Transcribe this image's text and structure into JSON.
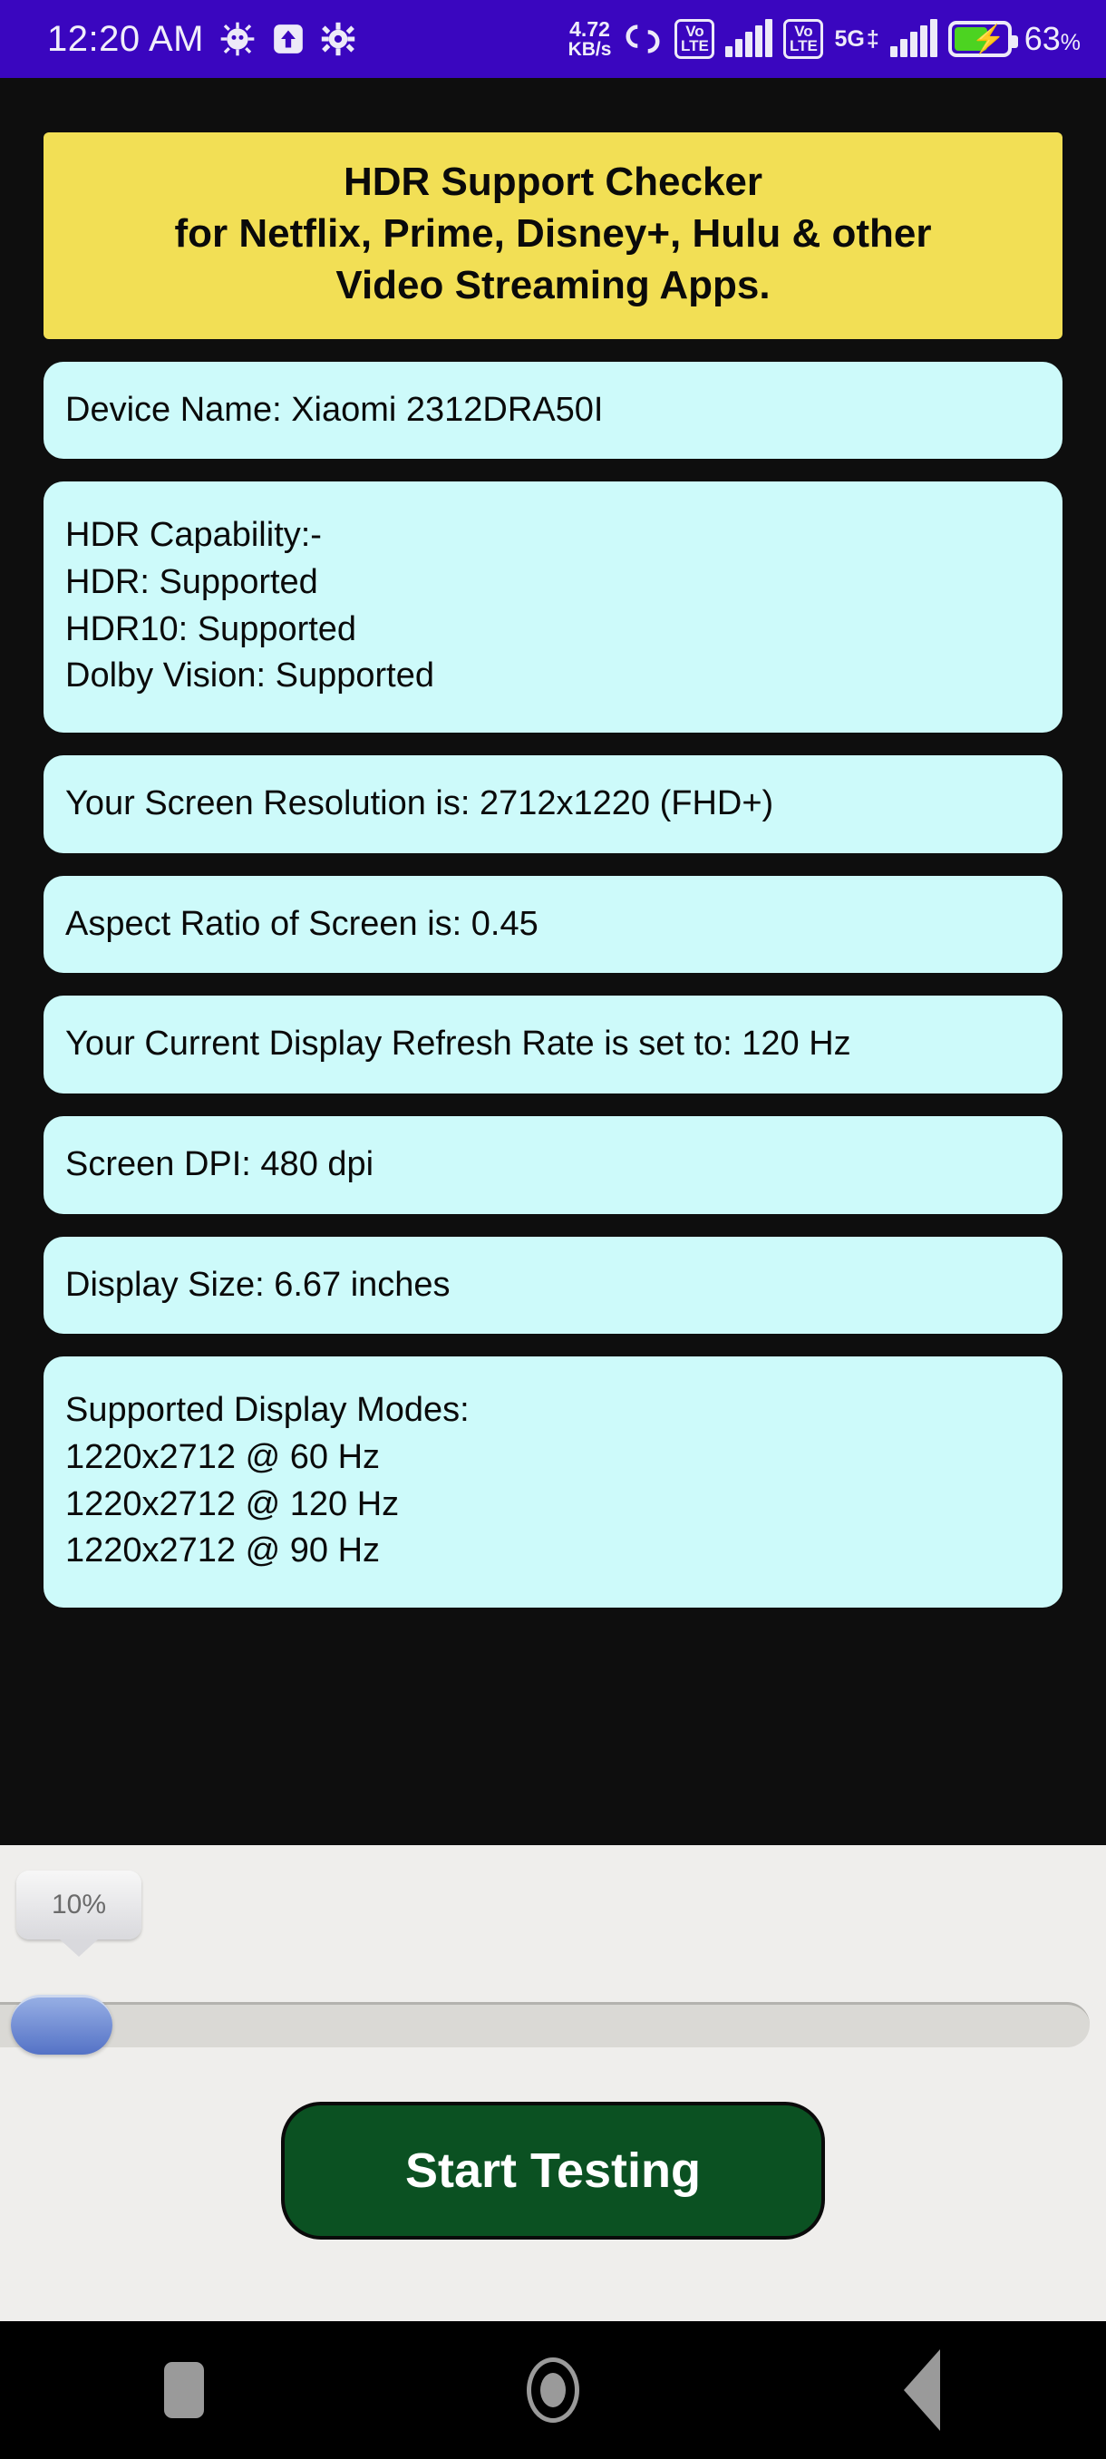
{
  "status_bar": {
    "time": "12:20 AM",
    "icons_left": [
      "android-bug-icon",
      "upload-arrow-icon",
      "gear-icon"
    ],
    "net_speed_value": "4.72",
    "net_speed_unit": "KB/s",
    "dual_sim_icon": "dual-sim-icon",
    "volte_line1": "Vo",
    "volte_line2": "LTE",
    "network_label": "5G",
    "network_suffix": "‡",
    "battery_percent": "63",
    "battery_percent_symbol": "%",
    "battery_level": 63,
    "charging": true,
    "background_color": "#3A06BF"
  },
  "banner": {
    "line1": "HDR Support Checker",
    "line2": "for Netflix, Prime, Disney+, Hulu & other",
    "line3": "Video Streaming Apps.",
    "background_color": "#F2DF55"
  },
  "cards": {
    "card_background_color": "#CDFAFA",
    "device_name": "Device Name: Xiaomi 2312DRA50I",
    "hdr_title": "HDR Capability:-",
    "hdr_line1": "HDR: Supported",
    "hdr_line2": "HDR10: Supported",
    "hdr_line3": "Dolby Vision: Supported",
    "resolution": "Your Screen Resolution is: 2712x1220 (FHD+)",
    "aspect_ratio": "Aspect Ratio of Screen is: 0.45",
    "refresh_rate": "Your Current Display Refresh Rate is set to: 120 Hz",
    "dpi": "Screen DPI: 480 dpi",
    "display_size": "Display Size: 6.67 inches",
    "modes_title": "Supported Display Modes:",
    "mode1": "1220x2712 @ 60 Hz",
    "mode2": "1220x2712 @ 120 Hz",
    "mode3": "1220x2712 @ 90 Hz"
  },
  "controls": {
    "slider_tooltip": "10%",
    "slider_value": 10,
    "slider_thumb_color": "#5472C6",
    "start_button_label": "Start Testing",
    "start_button_color": "#0B5122"
  },
  "navigation_bar": {
    "recents_icon": "square-recents-icon",
    "home_icon": "circle-home-icon",
    "back_icon": "triangle-back-icon"
  }
}
